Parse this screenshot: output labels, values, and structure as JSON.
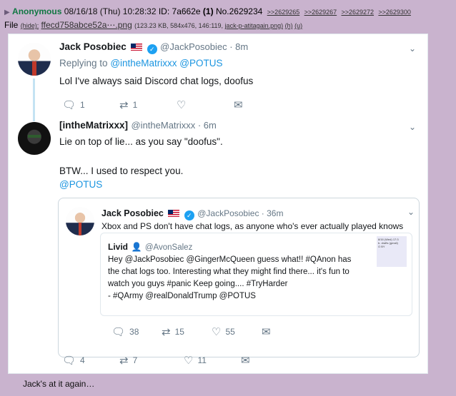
{
  "post": {
    "arrow": "▶",
    "name": "Anonymous",
    "date": "08/16/18 (Thu) 10:28:32",
    "id_label": "ID:",
    "id": "7a662e",
    "count": "(1)",
    "number": "No.2629234",
    "replies": [
      ">>2629265",
      ">>2629267",
      ">>2629272",
      ">>2629300"
    ]
  },
  "file": {
    "label": "File",
    "hide": "(hide):",
    "filename": "ffecd758abce52a⋯.png",
    "meta": "(123.23 KB, 584x476, 146:119,",
    "original": "jack-p-atitagain.png)",
    "h": "(h)",
    "u": "(u)"
  },
  "tweet1": {
    "name": "Jack Posobiec",
    "handle": "@JackPosobiec · 8m",
    "replying_label": "Replying to",
    "replying_to": "@intheMatrixxx @POTUS",
    "text": "Lol I've always said Discord chat logs, doofus",
    "replies": "1",
    "retweets": "1",
    "likes": ""
  },
  "tweet2": {
    "name": "[intheMatrixxx]",
    "handle": "@intheMatrixxx · 6m",
    "line1": "Lie on top of lie... as you say \"doofus\".",
    "line2": "BTW... I used to respect you.",
    "mention": "@POTUS",
    "replies": "4",
    "retweets": "7",
    "likes": "11"
  },
  "quote": {
    "name": "Jack Posobiec",
    "handle": "@JackPosobiec · 36m",
    "text": "Xbox and PS don't have chat logs, as anyone who's ever actually played knows",
    "replies": "38",
    "retweets": "15",
    "likes": "55"
  },
  "nested": {
    "name": "Livid",
    "handle": "@AvonSalez",
    "line1": "Hey @JackPosobiec @GingerMcQueen guess what!! #QAnon has",
    "line2": "the chat logs too. Interesting what they might find there... it's fun to",
    "line3": "watch you guys #panic Keep going.... #TryHarder",
    "line4": "- #QArmy @realDonaldTrump @POTUS",
    "side_lines": [
      "8/16 (Wed) 17:3",
      "b. drafts (gmail)",
      "O BY"
    ]
  },
  "caption": "Jack's at it again…",
  "colors": {
    "background": "#c9b3ce",
    "name": "#117743",
    "link": "#1b95e0"
  }
}
